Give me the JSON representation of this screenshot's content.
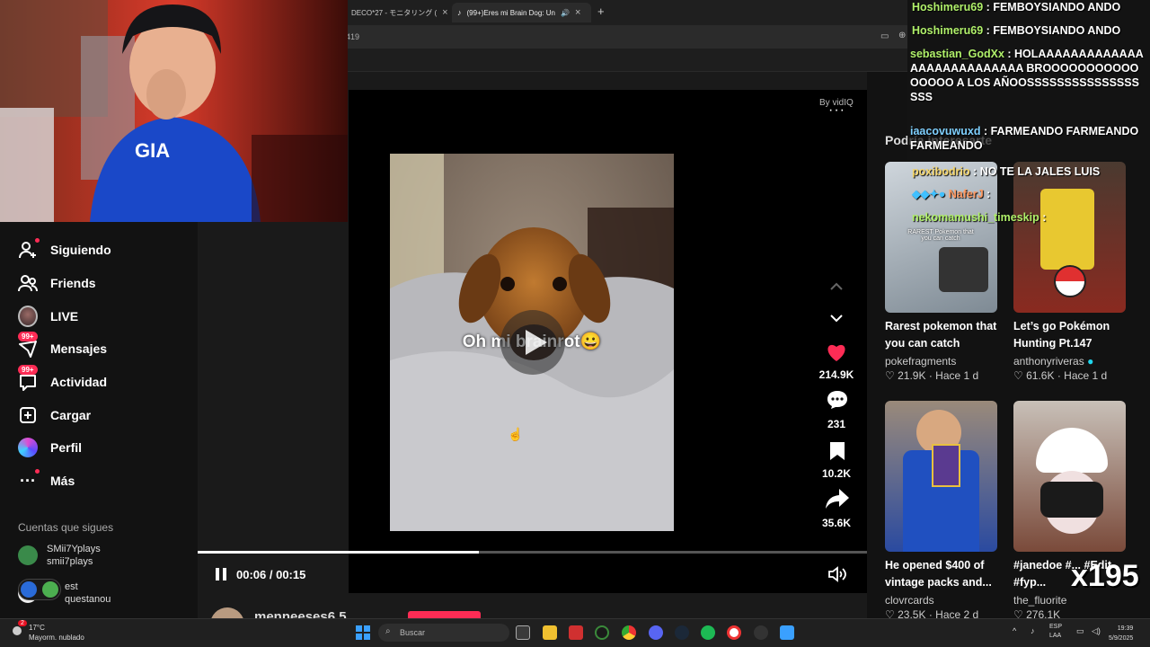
{
  "browser": {
    "tabs": [
      {
        "title": "DECO*27 - モニタリング (",
        "active": false
      },
      {
        "title": "(99+)Eres mi Brain Dog: Un",
        "active": true
      }
    ],
    "address_fragment": "419"
  },
  "sidebar": {
    "items": [
      {
        "label": "Siguiendo",
        "icon": "following-icon"
      },
      {
        "label": "Friends",
        "icon": "friends-icon"
      },
      {
        "label": "LIVE",
        "icon": "live-avatar-icon"
      },
      {
        "label": "Mensajes",
        "icon": "messages-icon",
        "badge": "99+"
      },
      {
        "label": "Actividad",
        "icon": "activity-icon",
        "badge": "99+"
      },
      {
        "label": "Cargar",
        "icon": "upload-icon"
      },
      {
        "label": "Perfil",
        "icon": "profile-icon"
      },
      {
        "label": "Más",
        "icon": "more-icon"
      }
    ],
    "following_title": "Cuentas que sigues",
    "following": [
      {
        "line1": "SMii7Yplays",
        "line2": "smii7plays"
      },
      {
        "line1": "est",
        "line2": "questanou"
      }
    ]
  },
  "video": {
    "caption": "Oh mi brainrot😀",
    "time": "00:06 / 00:15",
    "progress": 0.42,
    "by": "By vidIQ",
    "likes": "214.9K",
    "comments": "231",
    "saves": "10.2K",
    "shares": "35.6K",
    "author": "menneeses6.5"
  },
  "recommend": {
    "title": "Podría interesarte",
    "cards": [
      {
        "title": "Rarest pokemon that you can catch",
        "author": "pokefragments",
        "likes": "21.9K",
        "time": "Hace 1 d",
        "thumb_text": "RAREST Pokemon that you can catch"
      },
      {
        "title": "Let’s go Pokémon Hunting Pt.147",
        "author": "anthonyriveras",
        "likes": "61.6K",
        "time": "Hace 1 d",
        "verified": true
      },
      {
        "title": "He opened $400 of vintage packs and...",
        "author": "clovrcards",
        "likes": "23.5K",
        "time": "Hace 2 d"
      },
      {
        "title": "#janedoe #... #Edit #fyp...",
        "author": "the_fluorite",
        "likes": "276.1K",
        "time": ""
      }
    ]
  },
  "chat": [
    {
      "user": "Hoshimeru69",
      "msg": "FEMBOYSIANDO ANDO",
      "cls": "u1"
    },
    {
      "user": "Hoshimeru69",
      "msg": "FEMBOYSIANDO ANDO",
      "cls": "u1"
    },
    {
      "user": "sebastian_GodXx",
      "msg": "HOLAAAAAAAAAAAAAAAAAAAAAAAAAAA BROOOOOOOOOOOOOOOO A LOS AÑOOSSSSSSSSSSSSSSSSSS",
      "cls": "u1"
    },
    {
      "user": "iaacovuwuxd",
      "msg": "FARMEANDO FARMEANDO FARMEANDO",
      "cls": "u2"
    },
    {
      "user": "poxibodrio",
      "msg": "NO TE LA JALES LUIS",
      "cls": "u3"
    },
    {
      "user": "NaferJ",
      "msg": "",
      "cls": "u4"
    },
    {
      "user": "nekomamushi_timeskip",
      "msg": "",
      "cls": "u1"
    }
  ],
  "taskbar": {
    "temp": "17°C",
    "weather": "Mayorm. nublado",
    "weather_badge": "2",
    "search_placeholder": "Buscar",
    "lang": "ESP LAA",
    "time": "19:39",
    "date": "5/9/2025"
  },
  "watermark": "x195",
  "colors": {
    "accent": "#fe2c55",
    "like": "#fe2c55",
    "background": "#121212"
  }
}
